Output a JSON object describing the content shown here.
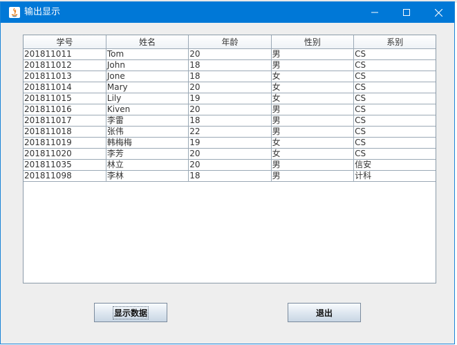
{
  "window": {
    "title": "输出显示"
  },
  "table": {
    "headers": [
      "学号",
      "姓名",
      "年龄",
      "性别",
      "系别"
    ],
    "rows": [
      [
        "201811011",
        "Tom",
        "20",
        "男",
        "CS"
      ],
      [
        "201811012",
        "John",
        "18",
        "男",
        "CS"
      ],
      [
        "201811013",
        "Jone",
        "18",
        "女",
        "CS"
      ],
      [
        "201811014",
        "Mary",
        "20",
        "女",
        "CS"
      ],
      [
        "201811015",
        "Lily",
        "19",
        "女",
        "CS"
      ],
      [
        "201811016",
        "Kiven",
        "20",
        "男",
        "CS"
      ],
      [
        "201811017",
        "李雷",
        "18",
        "男",
        "CS"
      ],
      [
        "201811018",
        "张伟",
        "22",
        "男",
        "CS"
      ],
      [
        "201811019",
        "韩梅梅",
        "19",
        "女",
        "CS"
      ],
      [
        "201811020",
        "李芳",
        "20",
        "女",
        "CS"
      ],
      [
        "201811035",
        "林立",
        "20",
        "男",
        "信安"
      ],
      [
        "201811098",
        "李林",
        "18",
        "男",
        "计科"
      ]
    ]
  },
  "buttons": {
    "show": "显示数据",
    "exit": "退出"
  },
  "colors": {
    "titlebar": "#0078d7",
    "window_bg": "#eeeeee",
    "grid": "#9aa8b5"
  }
}
